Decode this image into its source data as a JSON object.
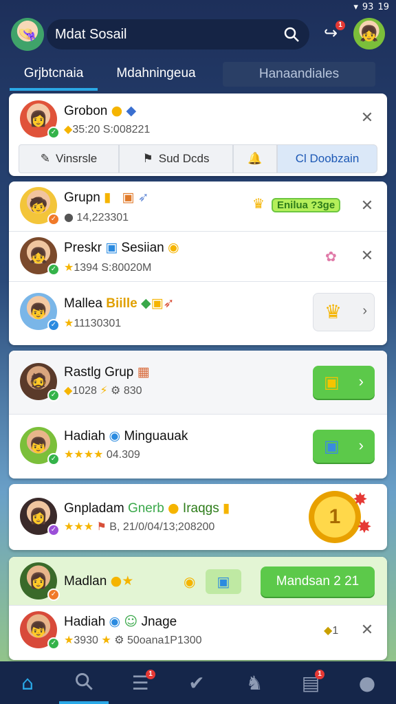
{
  "status": {
    "battery": "93",
    "time": "19"
  },
  "header": {
    "title": "Mdat Sosail",
    "notification_count": "1"
  },
  "tabs": [
    {
      "label": "Grjbtcnaia"
    },
    {
      "label": "Mdahningeua"
    },
    {
      "label": "Hanaandiales"
    }
  ],
  "top_card": {
    "name": "Grobon",
    "meta": "35:20 S:008221",
    "actions": [
      {
        "label": "Vinsrsle"
      },
      {
        "label": "Sud Dcds"
      },
      {
        "label": ""
      },
      {
        "label": "Cl Doobzain"
      }
    ]
  },
  "list_a": [
    {
      "name": "Grupn",
      "meta": "14,223301",
      "tag": "Enilua ?3ge"
    },
    {
      "name": "Preskr",
      "extra": "Sesiian",
      "meta": "1394 S:80020M"
    },
    {
      "name": "Mallea",
      "extra": "Biille",
      "meta": "11130301"
    }
  ],
  "list_b": [
    {
      "name": "Rastlg Grup",
      "meta": "1028",
      "meta2": "830"
    },
    {
      "name": "Hadiah",
      "extra": "Minguauak",
      "meta": "04.309"
    }
  ],
  "card_c": {
    "name": "Gnpladam",
    "extra1": "Gnerb",
    "extra2": "Iraqgs",
    "meta": "B, 21/0/04/13;208200"
  },
  "card_d": {
    "row1": {
      "name": "Madlan",
      "button": "Mandsan 2 21"
    },
    "row2": {
      "name": "Hadiah",
      "extra": "Jnage",
      "meta": "3930",
      "meta2": "50oana1P1300",
      "count": "1"
    }
  },
  "bottom_nav": [
    {
      "icon": "home-icon"
    },
    {
      "icon": "search-icon"
    },
    {
      "icon": "list-icon",
      "badge": "1"
    },
    {
      "icon": "check-icon"
    },
    {
      "icon": "user-wave-icon"
    },
    {
      "icon": "bag-icon",
      "badge": "1"
    },
    {
      "icon": "profile-icon"
    }
  ],
  "colors": {
    "accent": "#2aa8e6",
    "green": "#5cc94a",
    "navy": "#15264a"
  }
}
